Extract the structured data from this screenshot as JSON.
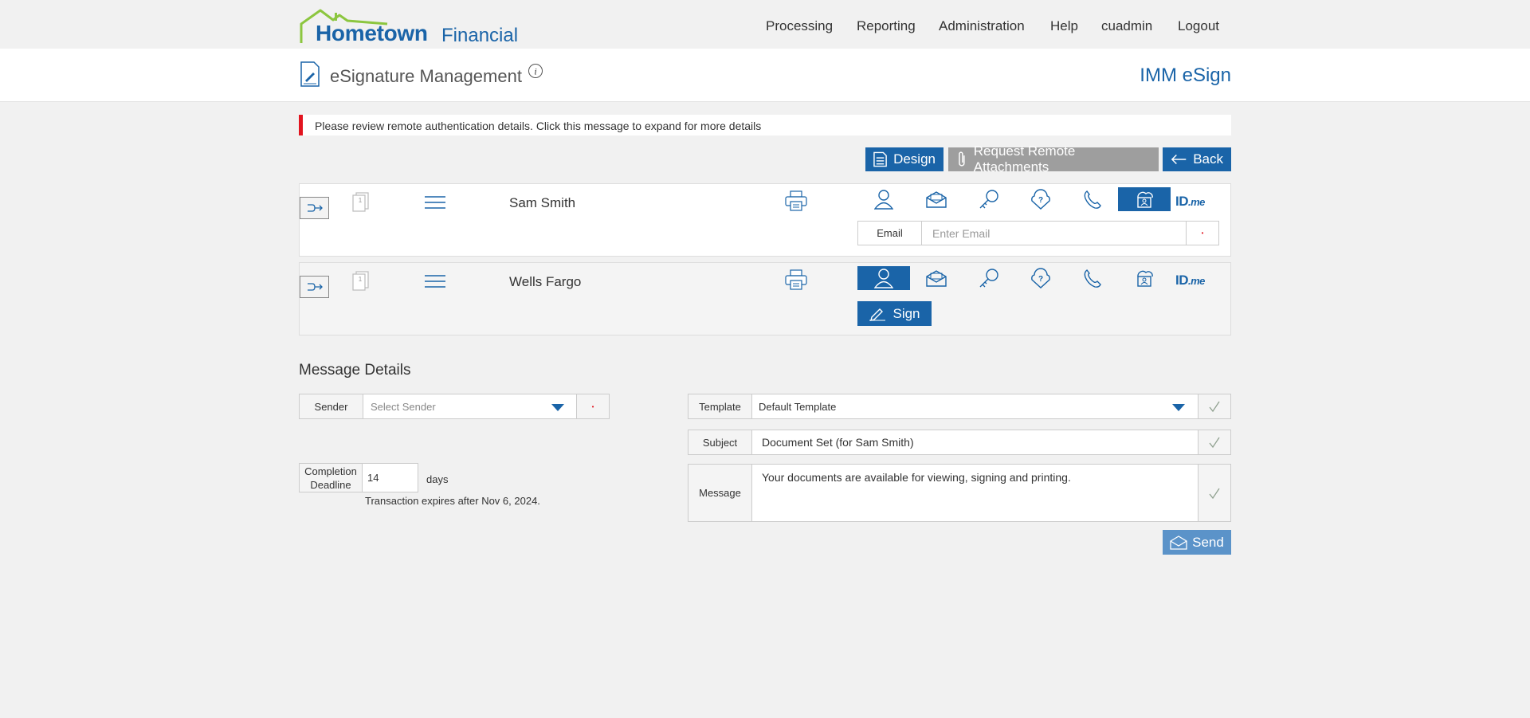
{
  "brand": {
    "name_part1": "Hometown",
    "name_part2": "Financial"
  },
  "nav": {
    "items": [
      "Processing",
      "Reporting",
      "Administration",
      "Help",
      "cuadmin",
      "Logout"
    ]
  },
  "header": {
    "title": "eSignature Management",
    "product": "IMM eSign"
  },
  "alert": {
    "text": "Please review remote authentication details. Click this message to expand for more details"
  },
  "actions": {
    "design": "Design",
    "request_attachments": "Request Remote Attachments",
    "back": "Back"
  },
  "signers": [
    {
      "name": "Sam Smith",
      "doc_count": "1",
      "active_auth": "in-person-photo-id",
      "email_label": "Email",
      "email_placeholder": "Enter Email",
      "required_marker": "•",
      "idme": "ID.me"
    },
    {
      "name": "Wells Fargo",
      "doc_count": "1",
      "active_auth": "in-person",
      "sign_label": "Sign",
      "idme": "ID.me"
    }
  ],
  "message_details": {
    "title": "Message Details",
    "sender": {
      "label": "Sender",
      "placeholder": "Select Sender",
      "required_marker": "•"
    },
    "template": {
      "label": "Template",
      "value": "Default Template"
    },
    "subject": {
      "label": "Subject",
      "value": "Document Set (for Sam Smith)"
    },
    "message": {
      "label": "Message",
      "value": "Your documents are available for viewing, signing and printing."
    },
    "deadline": {
      "label": "Completion Deadline",
      "value": "14",
      "unit": "days",
      "expires_note": "Transaction expires after Nov 6, 2024."
    },
    "send_label": "Send"
  },
  "colors": {
    "primary": "#1a64a8",
    "alert_bar": "#e2141f",
    "disabled_button": "#9e9e9e",
    "send_button": "#5b93c9",
    "logo_roof": "#8cc63f"
  }
}
